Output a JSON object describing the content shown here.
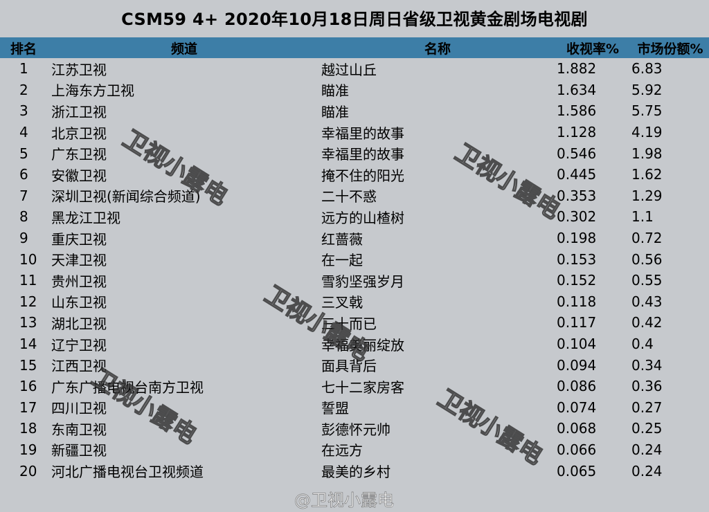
{
  "title": "CSM59 4+ 2020年10月18日周日省级卫视黄金剧场电视剧",
  "columns": [
    "排名",
    "频道",
    "名称",
    "收视率%",
    "市场份额%"
  ],
  "rows": [
    {
      "rank": "1",
      "channel": "江苏卫视",
      "name": "越过山丘",
      "rating": "1.882",
      "share": "6.83"
    },
    {
      "rank": "2",
      "channel": "上海东方卫视",
      "name": "瞄准",
      "rating": "1.634",
      "share": "5.92"
    },
    {
      "rank": "3",
      "channel": "浙江卫视",
      "name": "瞄准",
      "rating": "1.586",
      "share": "5.75"
    },
    {
      "rank": "4",
      "channel": "北京卫视",
      "name": "幸福里的故事",
      "rating": "1.128",
      "share": "4.19"
    },
    {
      "rank": "5",
      "channel": "广东卫视",
      "name": "幸福里的故事",
      "rating": "0.546",
      "share": "1.98"
    },
    {
      "rank": "6",
      "channel": "安徽卫视",
      "name": "掩不住的阳光",
      "rating": "0.445",
      "share": "1.62"
    },
    {
      "rank": "7",
      "channel": "深圳卫视(新闻综合频道)",
      "name": "二十不惑",
      "rating": "0.353",
      "share": "1.29"
    },
    {
      "rank": "8",
      "channel": "黑龙江卫视",
      "name": "远方的山楂树",
      "rating": "0.302",
      "share": "1.1"
    },
    {
      "rank": "9",
      "channel": "重庆卫视",
      "name": "红蔷薇",
      "rating": "0.198",
      "share": "0.72"
    },
    {
      "rank": "10",
      "channel": "天津卫视",
      "name": "在一起",
      "rating": "0.153",
      "share": "0.56"
    },
    {
      "rank": "11",
      "channel": "贵州卫视",
      "name": "雪豹坚强岁月",
      "rating": "0.152",
      "share": "0.55"
    },
    {
      "rank": "12",
      "channel": "山东卫视",
      "name": "三叉戟",
      "rating": "0.118",
      "share": "0.43"
    },
    {
      "rank": "13",
      "channel": "湖北卫视",
      "name": "三十而已",
      "rating": "0.117",
      "share": "0.42"
    },
    {
      "rank": "14",
      "channel": "辽宁卫视",
      "name": "幸福美丽绽放",
      "rating": "0.104",
      "share": "0.4"
    },
    {
      "rank": "15",
      "channel": "江西卫视",
      "name": "面具背后",
      "rating": "0.094",
      "share": "0.34"
    },
    {
      "rank": "16",
      "channel": "广东广播电视台南方卫视",
      "name": "七十二家房客",
      "rating": "0.086",
      "share": "0.36"
    },
    {
      "rank": "17",
      "channel": "四川卫视",
      "name": "誓盟",
      "rating": "0.074",
      "share": "0.27"
    },
    {
      "rank": "18",
      "channel": "东南卫视",
      "name": "彭德怀元帅",
      "rating": "0.068",
      "share": "0.25"
    },
    {
      "rank": "19",
      "channel": "新疆卫视",
      "name": "在远方",
      "rating": "0.066",
      "share": "0.24"
    },
    {
      "rank": "20",
      "channel": "河北广播电视台卫视频道",
      "name": "最美的乡村",
      "rating": "0.065",
      "share": "0.24"
    }
  ],
  "watermark": "卫视小露电",
  "weibo_watermark": "@卫视小露电"
}
